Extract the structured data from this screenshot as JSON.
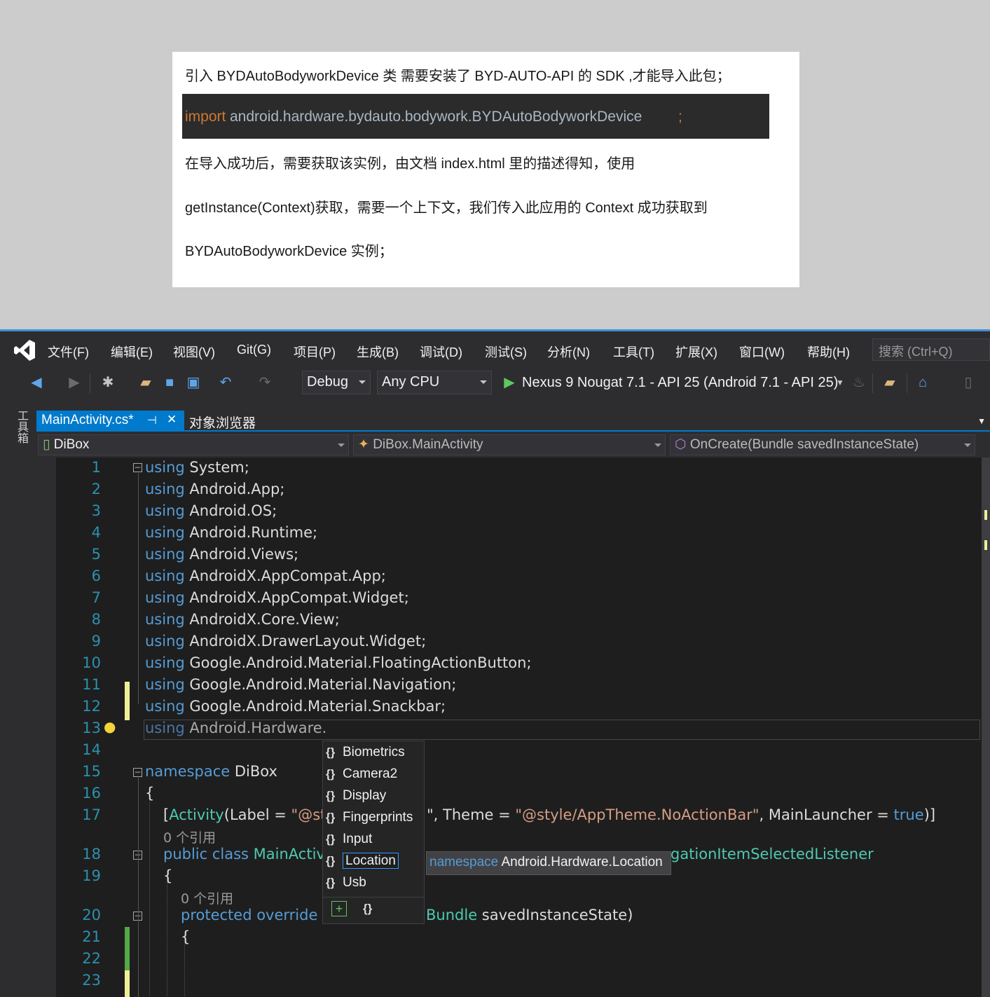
{
  "doc": {
    "line1": "引入 BYDAutoBodyworkDevice 类  需要安装了 BYD-AUTO-API 的 SDK ,才能导入此包；",
    "code_import": "import",
    "code_path": " android.hardware.bydauto.bodywork.BYDAutoBodyworkDevice",
    "code_semicolon": ";",
    "line2": "在导入成功后，需要获取该实例，由文档 index.html 里的描述得知，使用",
    "line3": "getInstance(Context)获取，需要一个上下文，我们传入此应用的 Context 成功获取到",
    "line4": "BYDAutoBodyworkDevice 实例；"
  },
  "menu": [
    "文件(F)",
    "编辑(E)",
    "视图(V)",
    "Git(G)",
    "项目(P)",
    "生成(B)",
    "调试(D)",
    "测试(S)",
    "分析(N)",
    "工具(T)",
    "扩展(X)",
    "窗口(W)",
    "帮助(H)"
  ],
  "search_placeholder": "搜索 (Ctrl+Q)",
  "toolbar": {
    "config": "Debug",
    "platform": "Any CPU",
    "run_target": "Nexus 9 Nougat 7.1 - API 25 (Android 7.1 - API 25)"
  },
  "toolbox_label": "工具箱",
  "tabs": {
    "active": "MainActivity.cs*",
    "pin": "⊣",
    "close": "✕",
    "other": "对象浏览器"
  },
  "nav": {
    "project": "DiBox",
    "class": "DiBox.MainActivity",
    "member": "OnCreate(Bundle savedInstanceState)"
  },
  "lines": [
    {
      "n": "1",
      "kw": "using",
      "rest": " System;"
    },
    {
      "n": "2",
      "kw": "using",
      "rest": " Android.App;"
    },
    {
      "n": "3",
      "kw": "using",
      "rest": " Android.OS;"
    },
    {
      "n": "4",
      "kw": "using",
      "rest": " Android.Runtime;"
    },
    {
      "n": "5",
      "kw": "using",
      "rest": " Android.Views;"
    },
    {
      "n": "6",
      "kw": "using",
      "rest": " AndroidX.AppCompat.App;"
    },
    {
      "n": "7",
      "kw": "using",
      "rest": " AndroidX.AppCompat.Widget;"
    },
    {
      "n": "8",
      "kw": "using",
      "rest": " AndroidX.Core.View;"
    },
    {
      "n": "9",
      "kw": "using",
      "rest": " AndroidX.DrawerLayout.Widget;"
    },
    {
      "n": "10",
      "kw": "using",
      "rest": " Google.Android.Material.FloatingActionButton;"
    },
    {
      "n": "11",
      "kw": "using",
      "rest": " Google.Android.Material.Navigation;"
    },
    {
      "n": "12",
      "kw": "using",
      "rest": " Google.Android.Material.Snackbar;"
    },
    {
      "n": "13",
      "kw": "using",
      "rest": " Android.Hardware."
    },
    {
      "n": "14",
      "kw": "",
      "rest": ""
    },
    {
      "n": "15",
      "kw": "namespace",
      "rest": " DiBox"
    },
    {
      "n": "16",
      "kw": "",
      "rest": "{"
    }
  ],
  "line17": {
    "n": "17",
    "a": "[",
    "attr": "Activity",
    "b": "(Label = ",
    "s1": "\"@str",
    "c": "\", Theme = ",
    "s2": "\"@style/AppTheme.NoActionBar\"",
    "d": ", MainLauncher = ",
    "t": "true",
    "e": ")]"
  },
  "ref1": "0 个引用",
  "line18": {
    "n": "18",
    "kw": "public class",
    "cls": " MainActivi",
    "tail": "gationItemSelectedListener"
  },
  "line19": {
    "n": "19",
    "text": "{"
  },
  "ref2": "0 个引用",
  "line20": {
    "n": "20",
    "kw": "protected override",
    "v": " v",
    "type": "Bundle",
    "rest": " savedInstanceState)"
  },
  "line21": {
    "n": "21",
    "text": "{"
  },
  "line22": {
    "n": "22"
  },
  "line23": {
    "n": "23"
  },
  "completion": [
    "Biometrics",
    "Camera2",
    "Display",
    "Fingerprints",
    "Input",
    "Location",
    "Usb"
  ],
  "ns_glyph": "{}",
  "tooltip": {
    "kw": "namespace",
    "name": " Android.Hardware.Location"
  }
}
